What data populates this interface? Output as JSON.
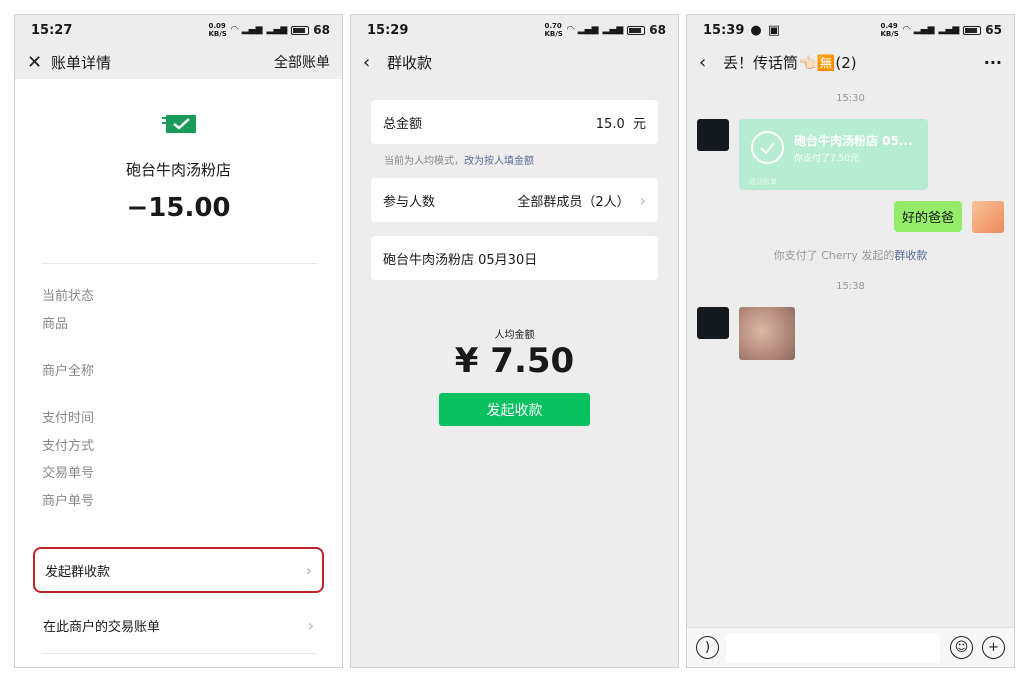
{
  "panel1": {
    "time": "15:27",
    "net": "0.09\nKB/S",
    "battery": "68",
    "nav_title": "账单详情",
    "nav_right": "全部账单",
    "merchant": "砲台牛肉汤粉店",
    "amount": "−15.00",
    "fields": [
      "当前状态",
      "商品",
      "商户全称",
      "支付时间",
      "支付方式",
      "交易单号",
      "商户单号"
    ],
    "rows": [
      "发起群收款",
      "在此商户的交易账单"
    ]
  },
  "panel2": {
    "time": "15:29",
    "net": "0.70\nKB/S",
    "battery": "68",
    "nav_title": "群收款",
    "total_label": "总金额",
    "total_value": "15.0  元",
    "hint": "当前为人均模式，",
    "hint_link": "改为按人填金额",
    "people_label": "参与人数",
    "people_value": "全部群成员（2人）",
    "note": "砲台牛肉汤粉店 05月30日",
    "per_label": "人均金额",
    "per_amount": "¥ 7.50",
    "button": "发起收款"
  },
  "panel3": {
    "time": "15:39",
    "net": "0.49\nKB/S",
    "battery": "65",
    "nav_title": "丢！传话筒👈🏻🈚(2)",
    "time1": "15:30",
    "transfer_title": "砲台牛肉汤粉店 05...",
    "transfer_sub": "你支付了7.50元",
    "transfer_foot": "活动账单",
    "my_message": "好的爸爸",
    "sys_text": "你支付了 Cherry 发起的",
    "sys_link": "群收款",
    "time2": "15:38"
  }
}
